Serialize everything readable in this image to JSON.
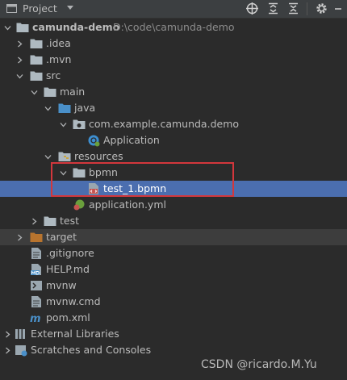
{
  "panel": {
    "title": "Project"
  },
  "tree": {
    "root_name": "camunda-demo",
    "root_path": "D:\\code\\camunda-demo",
    "idea": ".idea",
    "mvn": ".mvn",
    "src": "src",
    "main": "main",
    "java": "java",
    "package": "com.example.camunda.demo",
    "application_class": "Application",
    "resources": "resources",
    "bpmn_folder": "bpmn",
    "bpmn_file": "test_1.bpmn",
    "application_yml": "application.yml",
    "test": "test",
    "target": "target",
    "gitignore": ".gitignore",
    "help_md": "HELP.md",
    "mvnw": "mvnw",
    "mvnw_cmd": "mvnw.cmd",
    "pom": "pom.xml",
    "external_libraries": "External Libraries",
    "scratches": "Scratches and Consoles"
  },
  "watermark": "CSDN @ricardo.M.Yu",
  "colors": {
    "background": "#2b2b2b",
    "selection": "#4b6eaf",
    "highlight_box": "#d3373c",
    "folder": "#aeb9c0",
    "source_folder": "#4a90c9",
    "target_folder": "#b8742e"
  },
  "icons": {
    "toolbar": [
      "crosshair-icon",
      "expand-all-icon",
      "collapse-all-icon",
      "gear-icon"
    ]
  }
}
